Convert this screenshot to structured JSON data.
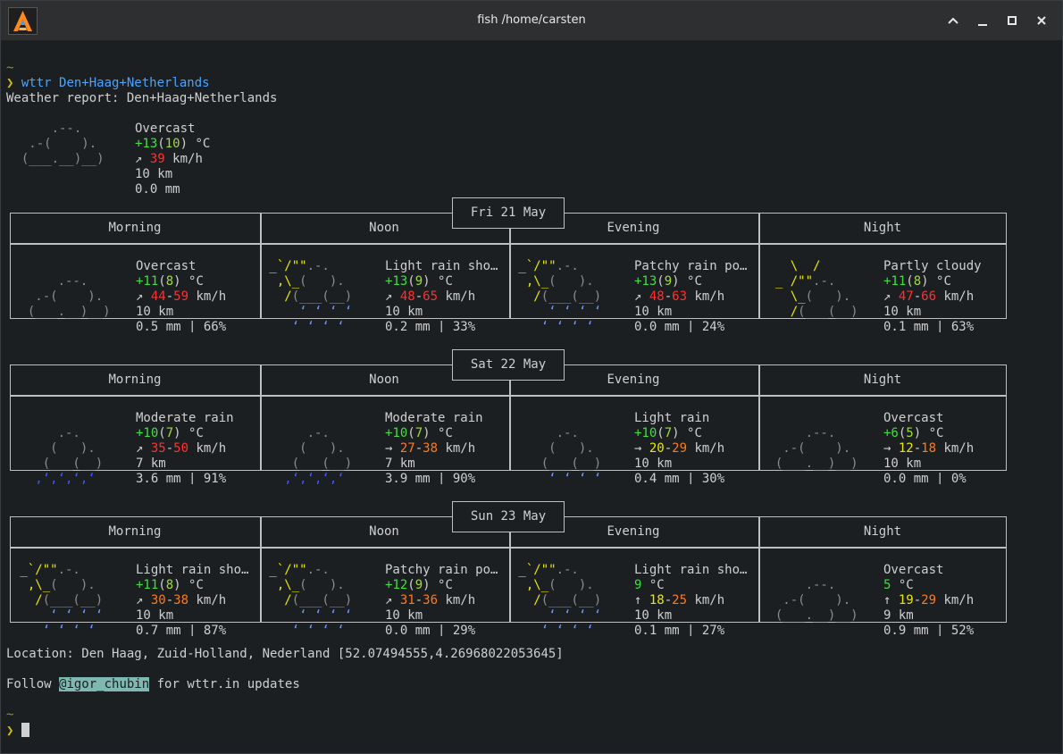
{
  "window": {
    "title": "fish /home/carsten"
  },
  "terminal": {
    "prompt_tilde": "~",
    "prompt_symbol": "❯",
    "command": "wttr Den+Haag+Netherlands",
    "report_line": "Weather report: Den+Haag+Netherlands",
    "current": {
      "condition": "Overcast",
      "temp": "+13",
      "feels": "10",
      "unit": "°C",
      "wind_arrow": "↗",
      "wind": "39",
      "wind_unit": "km/h",
      "visibility": "10 km",
      "precip": "0.0 mm"
    },
    "days": [
      {
        "date": "Fri 21 May",
        "periods": [
          {
            "name": "Morning",
            "condition": "Overcast",
            "temp": "+11",
            "feels": "8",
            "wind_arrow": "↗",
            "wind_low": "44",
            "wind_high": "59",
            "visibility": "10 km",
            "precip": "0.5 mm | 66%",
            "art": "overcast"
          },
          {
            "name": "Noon",
            "condition": "Light rain sho…",
            "temp": "+13",
            "feels": "9",
            "wind_arrow": "↗",
            "wind_low": "48",
            "wind_high": "65",
            "visibility": "10 km",
            "precip": "0.2 mm | 33%",
            "art": "sun-shower"
          },
          {
            "name": "Evening",
            "condition": "Patchy rain po…",
            "temp": "+13",
            "feels": "9",
            "wind_arrow": "↗",
            "wind_low": "48",
            "wind_high": "63",
            "visibility": "10 km",
            "precip": "0.0 mm | 24%",
            "art": "sun-shower"
          },
          {
            "name": "Night",
            "condition": "Partly cloudy",
            "temp": "+11",
            "feels": "8",
            "wind_arrow": "↗",
            "wind_low": "47",
            "wind_high": "66",
            "visibility": "10 km",
            "precip": "0.1 mm | 63%",
            "art": "partly-cloudy"
          }
        ]
      },
      {
        "date": "Sat 22 May",
        "periods": [
          {
            "name": "Morning",
            "condition": "Moderate rain",
            "temp": "+10",
            "feels": "7",
            "wind_arrow": "↗",
            "wind_low": "35",
            "wind_high": "50",
            "visibility": "7 km",
            "precip": "3.6 mm | 91%",
            "art": "heavy-rain"
          },
          {
            "name": "Noon",
            "condition": "Moderate rain",
            "temp": "+10",
            "feels": "7",
            "wind_arrow": "→",
            "wind_low": "27",
            "wind_high": "38",
            "visibility": "7 km",
            "precip": "3.9 mm | 90%",
            "art": "heavy-rain"
          },
          {
            "name": "Evening",
            "condition": "Light rain",
            "temp": "+10",
            "feels": "7",
            "wind_arrow": "→",
            "wind_low": "20",
            "wind_high": "29",
            "visibility": "10 km",
            "precip": "0.4 mm | 30%",
            "art": "light-rain"
          },
          {
            "name": "Night",
            "condition": "Overcast",
            "temp": "+6",
            "feels": "5",
            "wind_arrow": "→",
            "wind_low": "12",
            "wind_high": "18",
            "visibility": "10 km",
            "precip": "0.0 mm | 0%",
            "art": "overcast"
          }
        ]
      },
      {
        "date": "Sun 23 May",
        "periods": [
          {
            "name": "Morning",
            "condition": "Light rain sho…",
            "temp": "+11",
            "feels": "8",
            "wind_arrow": "↗",
            "wind_low": "30",
            "wind_high": "38",
            "visibility": "10 km",
            "precip": "0.7 mm | 87%",
            "art": "sun-shower"
          },
          {
            "name": "Noon",
            "condition": "Patchy rain po…",
            "temp": "+12",
            "feels": "9",
            "wind_arrow": "↗",
            "wind_low": "31",
            "wind_high": "36",
            "visibility": "10 km",
            "precip": "0.0 mm | 29%",
            "art": "sun-shower"
          },
          {
            "name": "Evening",
            "condition": "Light rain sho…",
            "temp": "9",
            "feels": "",
            "wind_arrow": "↑",
            "wind_low": "18",
            "wind_high": "25",
            "visibility": "10 km",
            "precip": "0.1 mm | 27%",
            "art": "sun-shower"
          },
          {
            "name": "Night",
            "condition": "Overcast",
            "temp": "5",
            "feels": "",
            "wind_arrow": "↑",
            "wind_low": "19",
            "wind_high": "29",
            "visibility": "9 km",
            "precip": "0.9 mm | 52%",
            "art": "overcast"
          }
        ]
      }
    ],
    "location_line": "Location: Den Haag, Zuid-Holland, Nederland [52.07494555,4.26968022053645]",
    "follow_prefix": "Follow ",
    "follow_handle": "@igor_chubin",
    "follow_suffix": " for wttr.in updates"
  }
}
